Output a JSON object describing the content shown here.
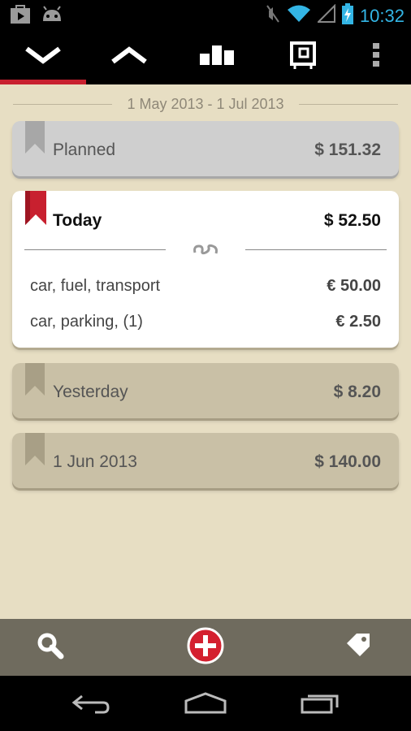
{
  "status_bar": {
    "time": "10:32",
    "icons": [
      "play-store-icon",
      "android-icon",
      "mute-icon",
      "wifi-icon",
      "signal-icon",
      "battery-charging-icon"
    ]
  },
  "toolbar": {
    "buttons": [
      "collapse-down-icon",
      "expand-up-icon",
      "bar-chart-icon",
      "calendar-frame-icon",
      "overflow-menu-icon"
    ],
    "active_index": 0,
    "accent_color": "#c8202f"
  },
  "date_range": "1 May 2013 - 1 Jul 2013",
  "groups": [
    {
      "label": "Planned",
      "amount": "$ 151.32",
      "state": "collapsed"
    },
    {
      "label": "Today",
      "amount": "$ 52.50",
      "state": "expanded",
      "entries": [
        {
          "description": "car, fuel, transport",
          "amount": "€ 50.00"
        },
        {
          "description": "car, parking, (1)",
          "amount": "€ 2.50"
        }
      ]
    },
    {
      "label": "Yesterday",
      "amount": "$ 8.20",
      "state": "collapsed"
    },
    {
      "label": "1 Jun 2013",
      "amount": "$ 140.00",
      "state": "collapsed"
    }
  ],
  "action_bar": {
    "buttons": [
      "search-icon",
      "add-icon",
      "tag-icon"
    ]
  },
  "nav_bar": {
    "buttons": [
      "back-icon",
      "home-icon",
      "recents-icon"
    ]
  }
}
